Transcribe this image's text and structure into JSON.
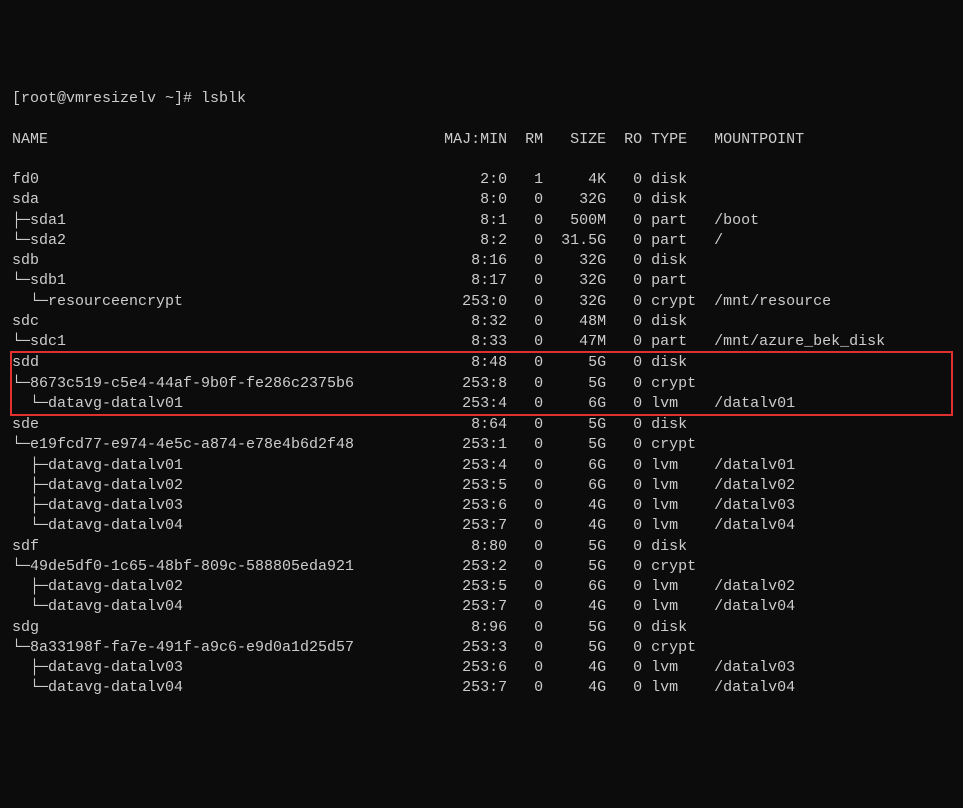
{
  "prompt": "[root@vmresizelv ~]# lsblk",
  "header": {
    "name": "NAME",
    "majmin": "MAJ:MIN",
    "rm": "RM",
    "size": "SIZE",
    "ro": "RO",
    "type": "TYPE",
    "mount": "MOUNTPOINT"
  },
  "rows": [
    {
      "pad": "",
      "tree": "",
      "name": "fd0",
      "mm": "2:0",
      "rm": "1",
      "size": "4K",
      "ro": "0",
      "type": "disk",
      "mount": ""
    },
    {
      "pad": "",
      "tree": "",
      "name": "sda",
      "mm": "8:0",
      "rm": "0",
      "size": "32G",
      "ro": "0",
      "type": "disk",
      "mount": ""
    },
    {
      "pad": "",
      "tree": "├─",
      "name": "sda1",
      "mm": "8:1",
      "rm": "0",
      "size": "500M",
      "ro": "0",
      "type": "part",
      "mount": "/boot"
    },
    {
      "pad": "",
      "tree": "└─",
      "name": "sda2",
      "mm": "8:2",
      "rm": "0",
      "size": "31.5G",
      "ro": "0",
      "type": "part",
      "mount": "/"
    },
    {
      "pad": "",
      "tree": "",
      "name": "sdb",
      "mm": "8:16",
      "rm": "0",
      "size": "32G",
      "ro": "0",
      "type": "disk",
      "mount": ""
    },
    {
      "pad": "",
      "tree": "└─",
      "name": "sdb1",
      "mm": "8:17",
      "rm": "0",
      "size": "32G",
      "ro": "0",
      "type": "part",
      "mount": ""
    },
    {
      "pad": "  ",
      "tree": "└─",
      "name": "resourceencrypt",
      "mm": "253:0",
      "rm": "0",
      "size": "32G",
      "ro": "0",
      "type": "crypt",
      "mount": "/mnt/resource"
    },
    {
      "pad": "",
      "tree": "",
      "name": "sdc",
      "mm": "8:32",
      "rm": "0",
      "size": "48M",
      "ro": "0",
      "type": "disk",
      "mount": ""
    },
    {
      "pad": "",
      "tree": "└─",
      "name": "sdc1",
      "mm": "8:33",
      "rm": "0",
      "size": "47M",
      "ro": "0",
      "type": "part",
      "mount": "/mnt/azure_bek_disk"
    },
    {
      "pad": "",
      "tree": "",
      "name": "sdd",
      "mm": "8:48",
      "rm": "0",
      "size": "5G",
      "ro": "0",
      "type": "disk",
      "mount": "",
      "hl": true
    },
    {
      "pad": "",
      "tree": "└─",
      "name": "8673c519-c5e4-44af-9b0f-fe286c2375b6",
      "mm": "253:8",
      "rm": "0",
      "size": "5G",
      "ro": "0",
      "type": "crypt",
      "mount": "",
      "hl": true
    },
    {
      "pad": "  ",
      "tree": "└─",
      "name": "datavg-datalv01",
      "mm": "253:4",
      "rm": "0",
      "size": "6G",
      "ro": "0",
      "type": "lvm",
      "mount": "/datalv01",
      "hl": true
    },
    {
      "pad": "",
      "tree": "",
      "name": "sde",
      "mm": "8:64",
      "rm": "0",
      "size": "5G",
      "ro": "0",
      "type": "disk",
      "mount": ""
    },
    {
      "pad": "",
      "tree": "└─",
      "name": "e19fcd77-e974-4e5c-a874-e78e4b6d2f48",
      "mm": "253:1",
      "rm": "0",
      "size": "5G",
      "ro": "0",
      "type": "crypt",
      "mount": ""
    },
    {
      "pad": "  ",
      "tree": "├─",
      "name": "datavg-datalv01",
      "mm": "253:4",
      "rm": "0",
      "size": "6G",
      "ro": "0",
      "type": "lvm",
      "mount": "/datalv01"
    },
    {
      "pad": "  ",
      "tree": "├─",
      "name": "datavg-datalv02",
      "mm": "253:5",
      "rm": "0",
      "size": "6G",
      "ro": "0",
      "type": "lvm",
      "mount": "/datalv02"
    },
    {
      "pad": "  ",
      "tree": "├─",
      "name": "datavg-datalv03",
      "mm": "253:6",
      "rm": "0",
      "size": "4G",
      "ro": "0",
      "type": "lvm",
      "mount": "/datalv03"
    },
    {
      "pad": "  ",
      "tree": "└─",
      "name": "datavg-datalv04",
      "mm": "253:7",
      "rm": "0",
      "size": "4G",
      "ro": "0",
      "type": "lvm",
      "mount": "/datalv04"
    },
    {
      "pad": "",
      "tree": "",
      "name": "sdf",
      "mm": "8:80",
      "rm": "0",
      "size": "5G",
      "ro": "0",
      "type": "disk",
      "mount": ""
    },
    {
      "pad": "",
      "tree": "└─",
      "name": "49de5df0-1c65-48bf-809c-588805eda921",
      "mm": "253:2",
      "rm": "0",
      "size": "5G",
      "ro": "0",
      "type": "crypt",
      "mount": ""
    },
    {
      "pad": "  ",
      "tree": "├─",
      "name": "datavg-datalv02",
      "mm": "253:5",
      "rm": "0",
      "size": "6G",
      "ro": "0",
      "type": "lvm",
      "mount": "/datalv02"
    },
    {
      "pad": "  ",
      "tree": "└─",
      "name": "datavg-datalv04",
      "mm": "253:7",
      "rm": "0",
      "size": "4G",
      "ro": "0",
      "type": "lvm",
      "mount": "/datalv04"
    },
    {
      "pad": "",
      "tree": "",
      "name": "sdg",
      "mm": "8:96",
      "rm": "0",
      "size": "5G",
      "ro": "0",
      "type": "disk",
      "mount": ""
    },
    {
      "pad": "",
      "tree": "└─",
      "name": "8a33198f-fa7e-491f-a9c6-e9d0a1d25d57",
      "mm": "253:3",
      "rm": "0",
      "size": "5G",
      "ro": "0",
      "type": "crypt",
      "mount": ""
    },
    {
      "pad": "  ",
      "tree": "├─",
      "name": "datavg-datalv03",
      "mm": "253:6",
      "rm": "0",
      "size": "4G",
      "ro": "0",
      "type": "lvm",
      "mount": "/datalv03"
    },
    {
      "pad": "  ",
      "tree": "└─",
      "name": "datavg-datalv04",
      "mm": "253:7",
      "rm": "0",
      "size": "4G",
      "ro": "0",
      "type": "lvm",
      "mount": "/datalv04"
    }
  ]
}
